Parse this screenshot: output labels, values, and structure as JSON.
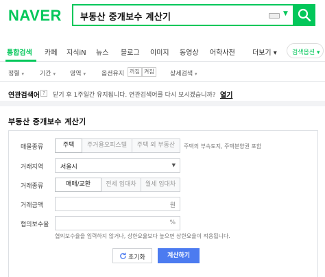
{
  "header": {
    "logo": "NAVER",
    "query": "부동산 중개보수 계산기"
  },
  "tabs": [
    {
      "label": "통합검색",
      "active": true
    },
    {
      "label": "카페"
    },
    {
      "label": "지식iN"
    },
    {
      "label": "뉴스"
    },
    {
      "label": "블로그"
    },
    {
      "label": "이미지"
    },
    {
      "label": "동영상"
    },
    {
      "label": "어학사전"
    },
    {
      "label": "더보기 ▾"
    }
  ],
  "tab_option": "검색옵션 ▾",
  "filters": {
    "sort": "정렬",
    "period": "기간",
    "area": "영역",
    "option_keep": "옵션유지",
    "chip_off": "꺼짐",
    "chip_on": "켜짐",
    "detail": "상세검색"
  },
  "related": {
    "label": "연관검색어",
    "help": "?",
    "message": "닫기 후 1주일간 유지됩니다. 연관검색어를 다시 보시겠습니까?",
    "link": "열기"
  },
  "calculator": {
    "title": "부동산 중개보수 계산기",
    "property_type": {
      "label": "매물종류",
      "options": [
        "주택",
        "주거용오피스텔",
        "주택 외 부동산"
      ],
      "selected": 0,
      "helper": "주택의 부속토지, 주택분양권 포함"
    },
    "region": {
      "label": "거래지역",
      "value": "서울시"
    },
    "deal_type": {
      "label": "거래종류",
      "options": [
        "매매/교환",
        "전세 임대차",
        "월세 임대차"
      ],
      "selected": 0
    },
    "amount": {
      "label": "거래금액",
      "unit": "원"
    },
    "fee_rate": {
      "label": "협의보수율",
      "unit": "%",
      "helper": "협의보수율을 입력하지 않거나, 상한요율보다 높으면 상한요율이 적용됩니다."
    },
    "reset_label": "초기화",
    "calc_label": "계산하기"
  },
  "colors": {
    "brand": "#03c75a",
    "button": "#4c7bf0"
  }
}
